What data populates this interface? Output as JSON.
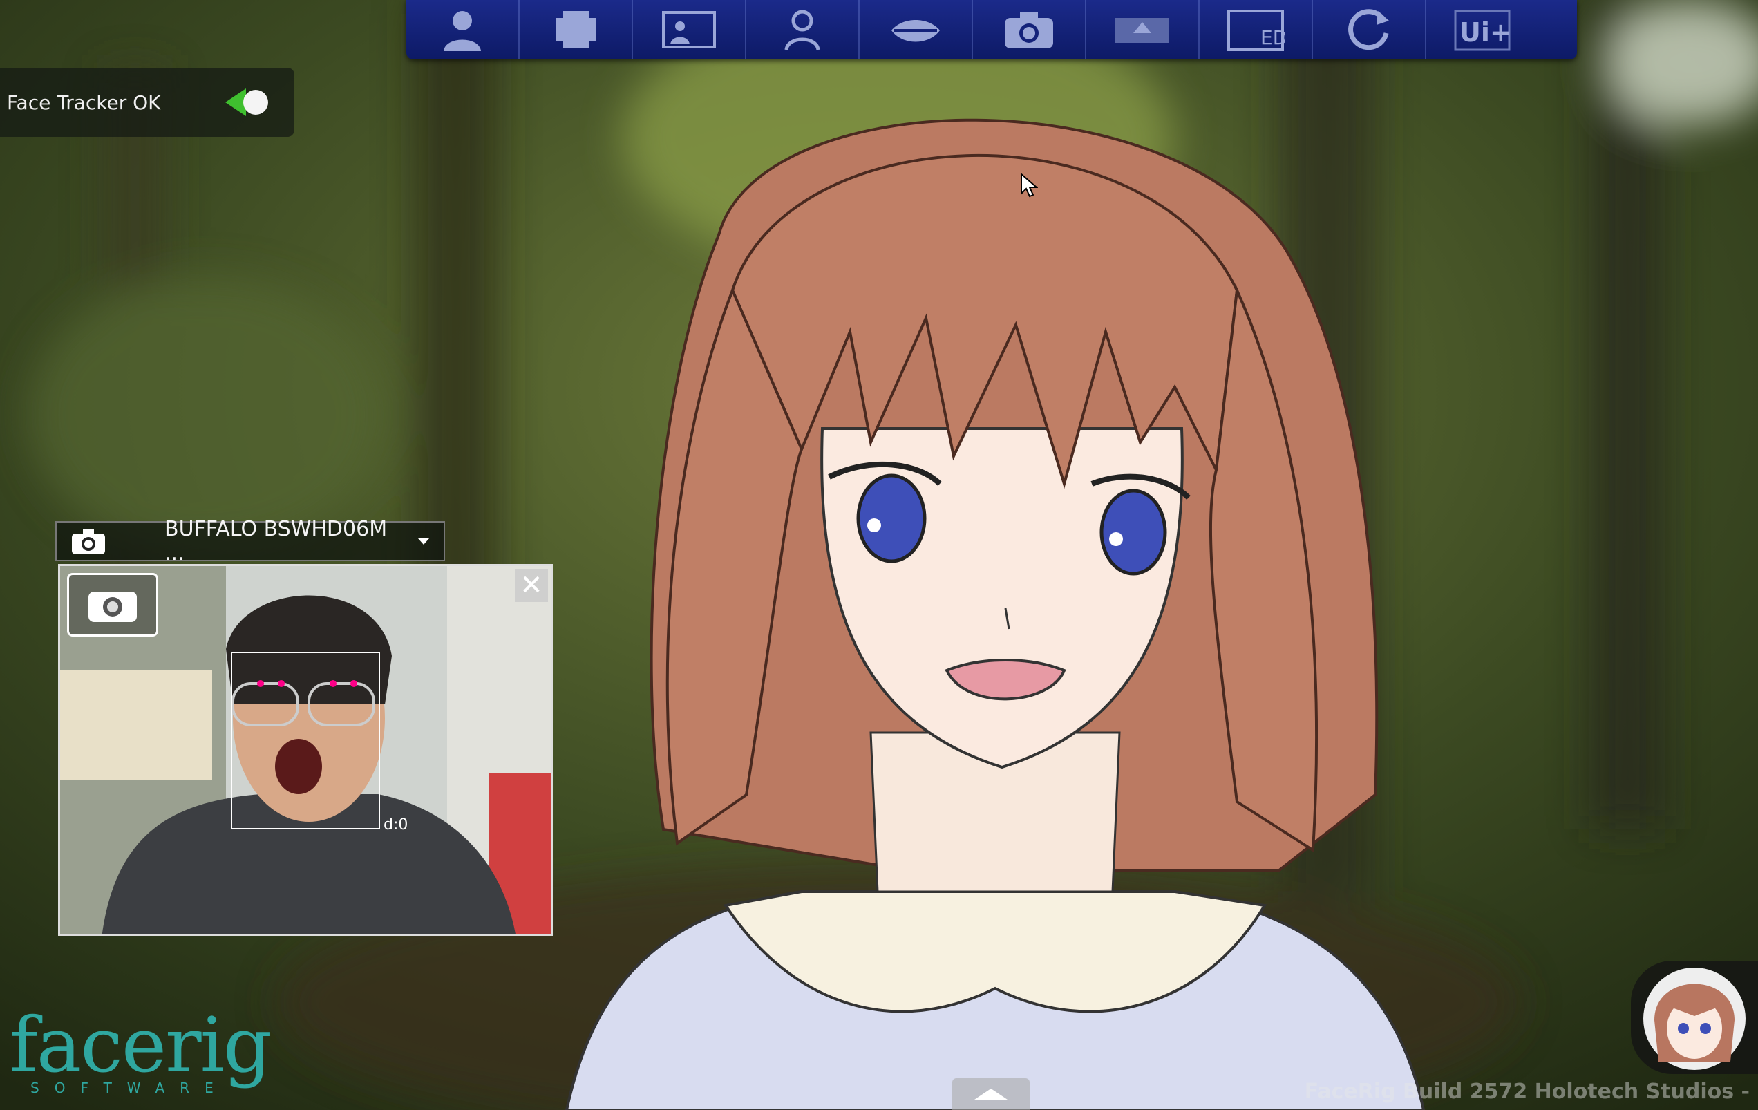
{
  "toolbar": {
    "buttons": [
      {
        "icon": "avatar-icon"
      },
      {
        "icon": "layers-icon"
      },
      {
        "icon": "background-icon"
      },
      {
        "icon": "props-icon"
      },
      {
        "icon": "mouth-icon"
      },
      {
        "icon": "camera-icon"
      },
      {
        "icon": "broadcast-icon"
      },
      {
        "icon": "ed-icon",
        "label": "ED"
      },
      {
        "icon": "refresh-icon"
      },
      {
        "icon": "ui-plus-icon",
        "label": "Ui+"
      }
    ]
  },
  "status": {
    "text": "Face Tracker OK"
  },
  "webcam": {
    "device": "BUFFALO BSWHD06M ...",
    "close_label": "✕",
    "depth_label": "d:0"
  },
  "logo": {
    "word": "facerig",
    "sub": "SOFTWARE"
  },
  "build": "FaceRig Build 2572 Holotech Studios -",
  "colors": {
    "toolbar": "#14227a",
    "accent_green": "#3fbf2f",
    "logo": "#2fa7a0"
  }
}
